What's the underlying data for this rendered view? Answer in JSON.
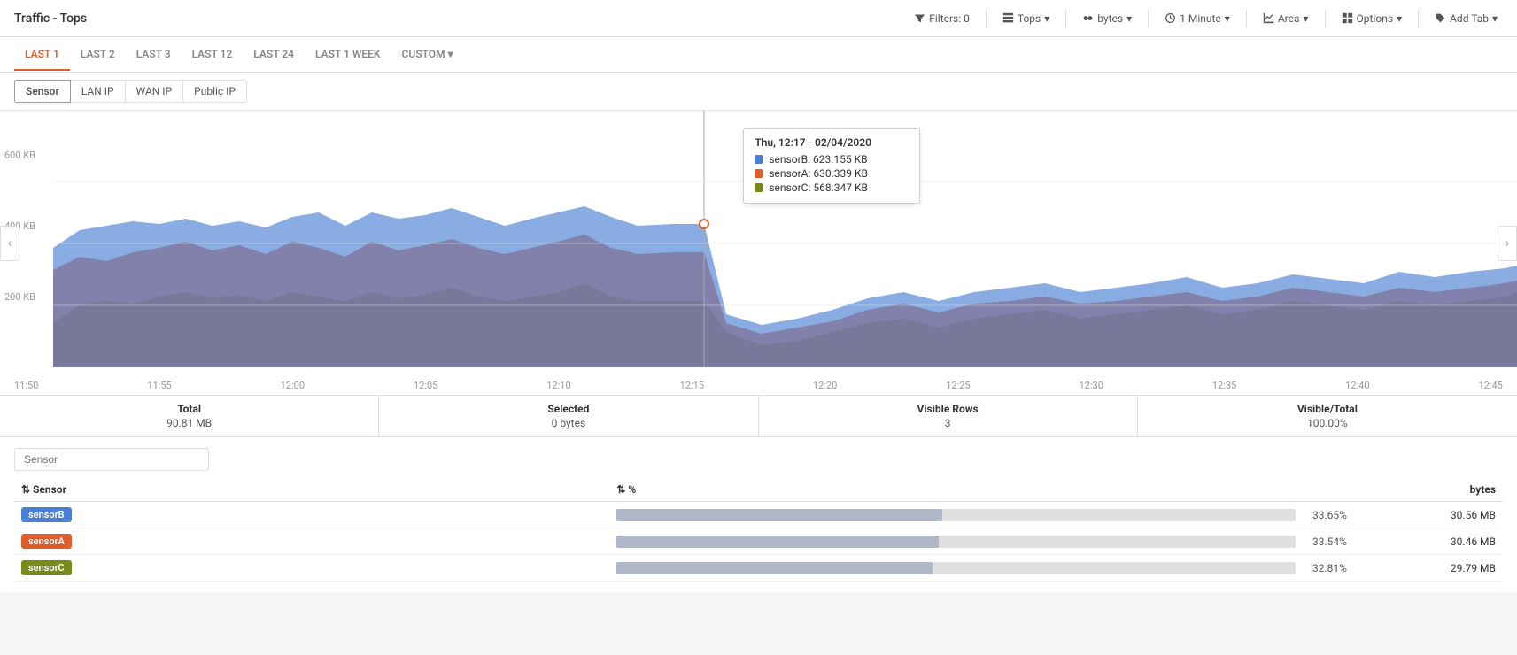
{
  "page": {
    "title": "Traffic - Tops"
  },
  "topbar": {
    "filters_label": "Filters: 0",
    "tops_label": "Tops",
    "bytes_label": "bytes",
    "minute_label": "1 Minute",
    "area_label": "Area",
    "options_label": "Options",
    "addtab_label": "Add Tab"
  },
  "time_tabs": [
    {
      "id": "last1",
      "label": "LAST 1",
      "active": true
    },
    {
      "id": "last2",
      "label": "LAST 2",
      "active": false
    },
    {
      "id": "last3",
      "label": "LAST 3",
      "active": false
    },
    {
      "id": "last12",
      "label": "LAST 12",
      "active": false
    },
    {
      "id": "last24",
      "label": "LAST 24",
      "active": false
    },
    {
      "id": "last1week",
      "label": "LAST 1 WEEK",
      "active": false
    },
    {
      "id": "custom",
      "label": "CUSTOM",
      "active": false,
      "dropdown": true
    }
  ],
  "sub_tabs": [
    {
      "id": "sensor",
      "label": "Sensor",
      "active": true
    },
    {
      "id": "lanip",
      "label": "LAN IP",
      "active": false
    },
    {
      "id": "wanip",
      "label": "WAN IP",
      "active": false
    },
    {
      "id": "publicip",
      "label": "Public IP",
      "active": false
    }
  ],
  "chart": {
    "y_labels": [
      "600 KB",
      "400 KB",
      "200 KB"
    ],
    "x_labels": [
      "11:50",
      "11:55",
      "12:00",
      "12:05",
      "12:10",
      "12:15",
      "12:20",
      "12:25",
      "12:30",
      "12:35",
      "12:40",
      "12:45"
    ],
    "cursor_position_pct": 46.5,
    "tooltip": {
      "title": "Thu, 12:17 - 02/04/2020",
      "rows": [
        {
          "color": "#4a7fd4",
          "label": "sensorB: 623.155 KB"
        },
        {
          "color": "#e05c2a",
          "label": "sensorA: 630.339 KB"
        },
        {
          "color": "#7a8a1a",
          "label": "sensorC: 568.347 KB"
        }
      ]
    }
  },
  "stats": {
    "total_label": "Total",
    "total_value": "90.81 MB",
    "selected_label": "Selected",
    "selected_value": "0 bytes",
    "visible_rows_label": "Visible Rows",
    "visible_rows_value": "3",
    "visible_total_label": "Visible/Total",
    "visible_total_value": "100.00%"
  },
  "table": {
    "search_placeholder": "Sensor",
    "col_sensor": "⇅ Sensor",
    "col_pct": "⇅ %",
    "col_bytes": "bytes",
    "rows": [
      {
        "sensor": "sensorB",
        "badge_class": "badge-blue",
        "pct": "33.65%",
        "pct_width": 48,
        "bytes": "30.56 MB"
      },
      {
        "sensor": "sensorA",
        "badge_class": "badge-red",
        "pct": "33.54%",
        "pct_width": 47.5,
        "bytes": "30.46 MB"
      },
      {
        "sensor": "sensorC",
        "badge_class": "badge-olive",
        "pct": "32.81%",
        "pct_width": 46.5,
        "bytes": "29.79 MB"
      }
    ]
  },
  "colors": {
    "sensorB": "#4a7fd4",
    "sensorA": "#e05c2a",
    "sensorC": "#7a8a1a",
    "olive_dark": "#6b7a10",
    "accent": "#e05c2a"
  }
}
